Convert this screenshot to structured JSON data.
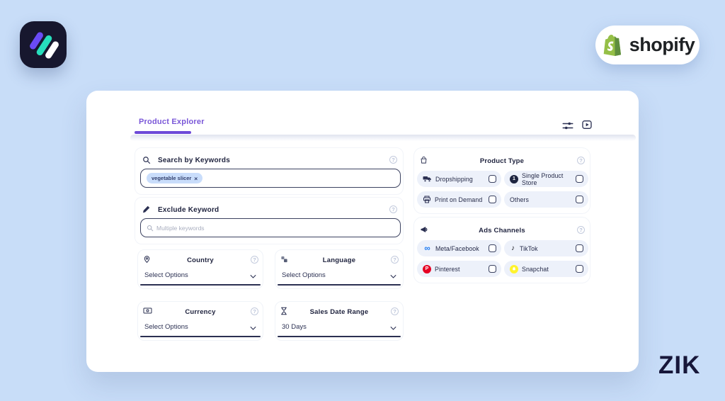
{
  "brand": {
    "zik_wordmark": "ZIK",
    "shopify_label": "shopify"
  },
  "tabs": {
    "product_explorer": "Product Explorer"
  },
  "filters": {
    "search": {
      "label": "Search by Keywords",
      "chip": "vegetable slicer"
    },
    "exclude": {
      "label": "Exclude Keyword",
      "placeholder": "Multiple keywords"
    },
    "country": {
      "label": "Country",
      "value": "Select Options"
    },
    "language": {
      "label": "Language",
      "value": "Select Options"
    },
    "currency": {
      "label": "Currency",
      "value": "Select Options"
    },
    "sales_date_range": {
      "label": "Sales Date Range",
      "value": "30 Days"
    }
  },
  "product_type": {
    "title": "Product Type",
    "options": [
      {
        "label": "Dropshipping"
      },
      {
        "label": "Single Product Store"
      },
      {
        "label": "Print on Demand"
      },
      {
        "label": "Others"
      }
    ]
  },
  "ads_channels": {
    "title": "Ads Channels",
    "options": [
      {
        "label": "Meta/Facebook"
      },
      {
        "label": "TikTok"
      },
      {
        "label": "Pinterest"
      },
      {
        "label": "Snapchat"
      }
    ]
  },
  "glyphs": {
    "help": "?",
    "chip_remove": "×",
    "meta": "∞",
    "tiktok": "♪",
    "single_product": "1",
    "pinterest": "P"
  },
  "colors": {
    "background": "#c8ddf8",
    "card": "#ffffff",
    "accent_purple": "#6d49d8",
    "navy_text": "#2b3052",
    "chip_bg": "#c9ddfb",
    "pill_bg": "#edf1fa",
    "meta_blue": "#1877f2",
    "pinterest_red": "#e60023",
    "snapchat_yellow": "#fff32e",
    "shopify_green": "#95bf47",
    "logo_purple": "#6a4bf4",
    "logo_teal": "#27debc"
  }
}
